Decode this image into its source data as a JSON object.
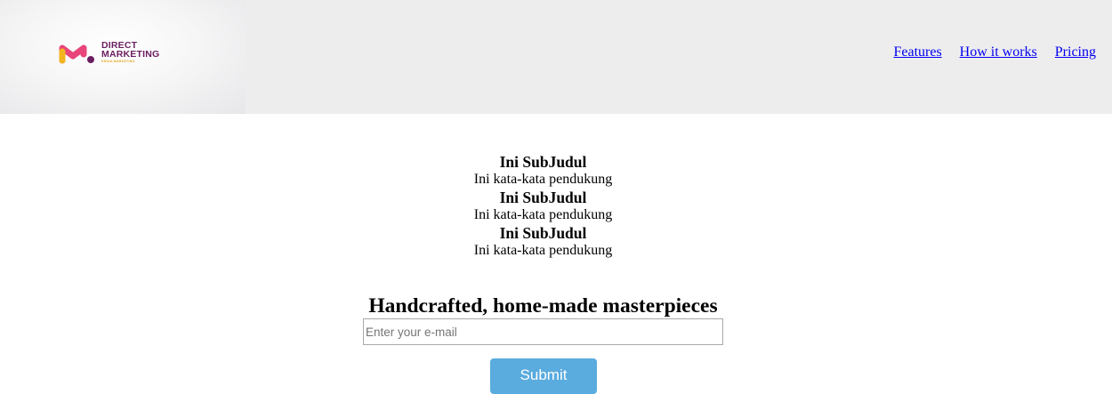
{
  "header": {
    "background_color": "#eeedee",
    "logo": {
      "name_line1": "DIRECT",
      "name_line2": "MARKETING",
      "tagline": "KRAULMARKETING",
      "colors": {
        "pink": "#e8457a",
        "yellow": "#f2b51f",
        "purple": "#6b1e61"
      }
    },
    "nav": [
      {
        "label": "Features"
      },
      {
        "label": "How it works"
      },
      {
        "label": "Pricing"
      }
    ]
  },
  "features": [
    {
      "title": "Ini SubJudul",
      "description": "Ini kata-kata pendukung"
    },
    {
      "title": "Ini SubJudul",
      "description": "Ini kata-kata pendukung"
    },
    {
      "title": "Ini SubJudul",
      "description": "Ini kata-kata pendukung"
    }
  ],
  "hero": {
    "title": "Handcrafted, home-made masterpieces"
  },
  "form": {
    "email_value": "",
    "email_placeholder": "Enter your e-mail",
    "submit_label": "Submit",
    "submit_color": "#5aabde"
  }
}
